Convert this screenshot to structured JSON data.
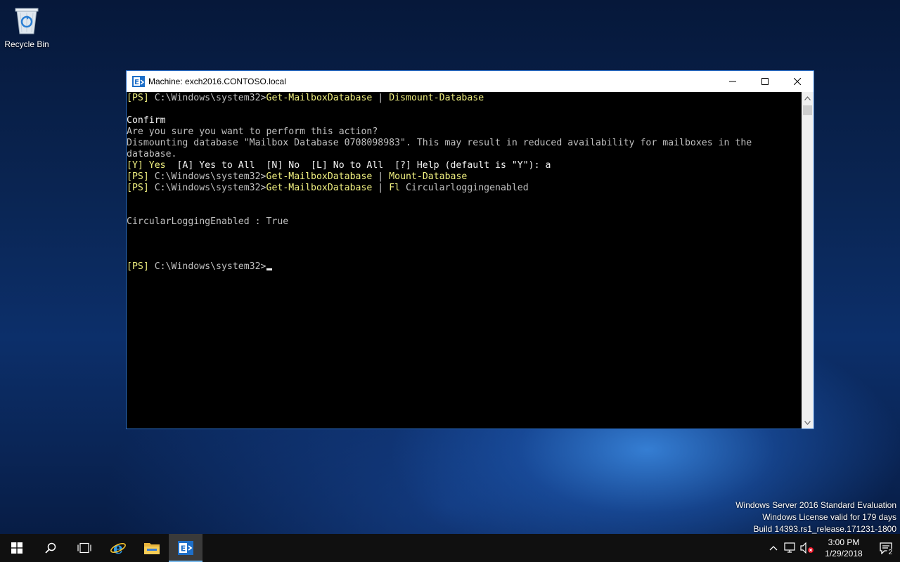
{
  "desktop": {
    "recycle_bin_label": "Recycle Bin"
  },
  "window": {
    "title": "Machine: exch2016.CONTOSO.local",
    "minimize_glyph": "—",
    "lines": [
      [
        {
          "t": "[PS] ",
          "c": "y"
        },
        {
          "t": "C:\\Windows\\system32>",
          "c": "g"
        },
        {
          "t": "Get-MailboxDatabase",
          "c": "y"
        },
        {
          "t": " | ",
          "c": "g"
        },
        {
          "t": "Dismount-Database",
          "c": "y"
        }
      ],
      [],
      [
        {
          "t": "Confirm",
          "c": "w"
        }
      ],
      [
        {
          "t": "Are you sure you want to perform this action?",
          "c": "g"
        }
      ],
      [
        {
          "t": "Dismounting database \"Mailbox Database 0708098983\". This may result in reduced availability for mailboxes in the",
          "c": "g"
        }
      ],
      [
        {
          "t": "database.",
          "c": "g"
        }
      ],
      [
        {
          "t": "[Y] Yes",
          "c": "y"
        },
        {
          "t": "  [A] Yes to All  [N] No  [L] No to All  [?] Help (default is \"Y\"): a",
          "c": "w"
        }
      ],
      [
        {
          "t": "[PS] ",
          "c": "y"
        },
        {
          "t": "C:\\Windows\\system32>",
          "c": "g"
        },
        {
          "t": "Get-MailboxDatabase",
          "c": "y"
        },
        {
          "t": " | ",
          "c": "g"
        },
        {
          "t": "Mount-Database",
          "c": "y"
        }
      ],
      [
        {
          "t": "[PS] ",
          "c": "y"
        },
        {
          "t": "C:\\Windows\\system32>",
          "c": "g"
        },
        {
          "t": "Get-MailboxDatabase",
          "c": "y"
        },
        {
          "t": " | ",
          "c": "g"
        },
        {
          "t": "Fl",
          "c": "y"
        },
        {
          "t": " Circularloggingenabled",
          "c": "g"
        }
      ],
      [],
      [],
      [
        {
          "t": "CircularLoggingEnabled : True",
          "c": "g"
        }
      ],
      [],
      [],
      [],
      [
        {
          "t": "[PS] ",
          "c": "y"
        },
        {
          "t": "C:\\Windows\\system32>",
          "c": "g"
        },
        {
          "cursor": true
        }
      ]
    ]
  },
  "watermark": {
    "line1": "Windows Server 2016 Standard Evaluation",
    "line2": "Windows License valid for 179 days",
    "line3": "Build 14393.rs1_release.171231-1800"
  },
  "taskbar": {
    "time": "3:00 PM",
    "date": "1/29/2018",
    "notification_count": "2"
  },
  "colors": {
    "accent": "#76b9ed",
    "prompt_yellow": "#f0f080",
    "console_text": "#c0c0c0",
    "window_border": "#2a6fc9"
  }
}
